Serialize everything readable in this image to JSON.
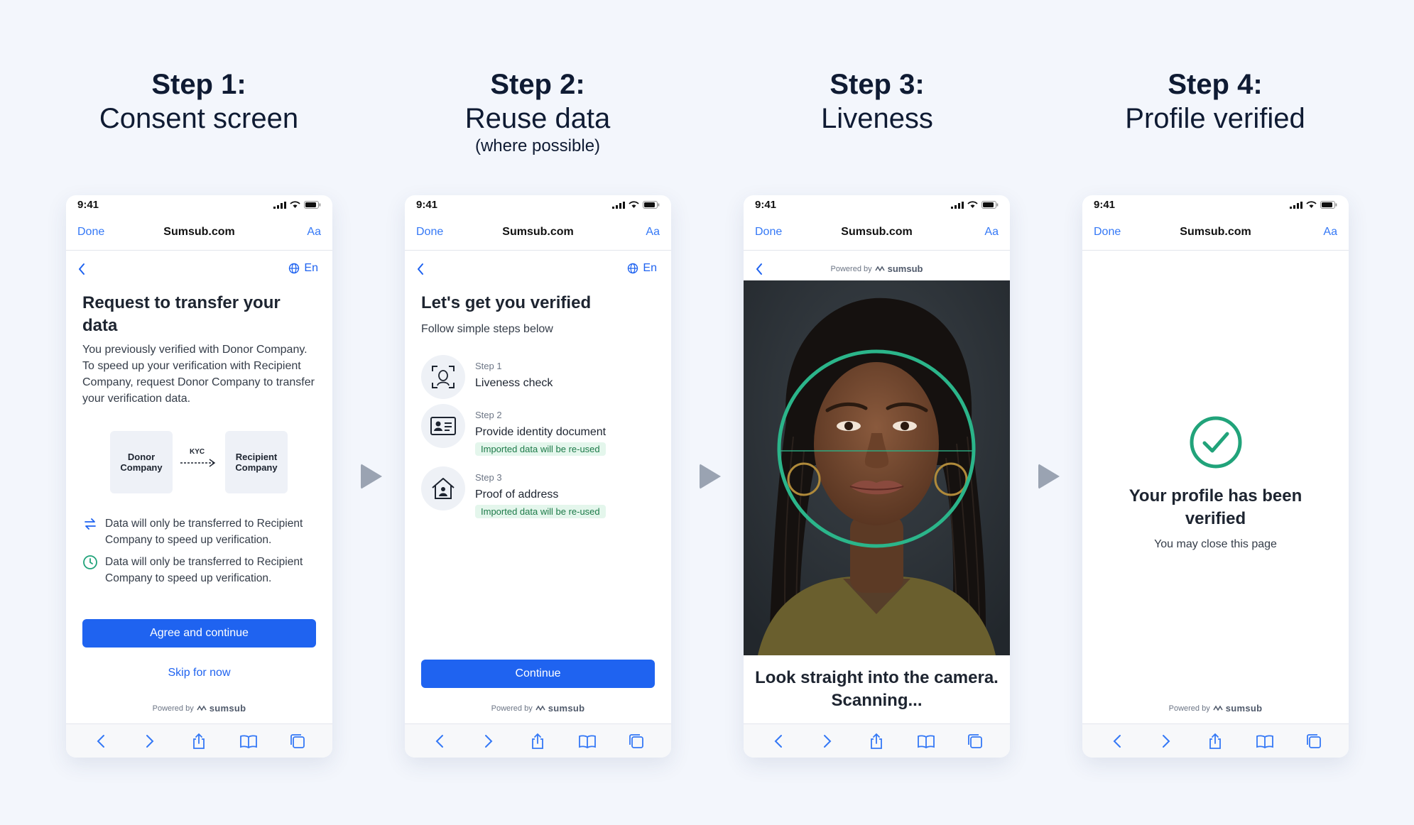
{
  "steps": [
    {
      "title": "Step 1:",
      "subtitle": "Consent screen",
      "note": ""
    },
    {
      "title": "Step 2:",
      "subtitle": "Reuse data",
      "note": "(where possible)"
    },
    {
      "title": "Step 3:",
      "subtitle": "Liveness",
      "note": ""
    },
    {
      "title": "Step 4:",
      "subtitle": "Profile verified",
      "note": ""
    }
  ],
  "status": {
    "time": "9:41"
  },
  "browser": {
    "done": "Done",
    "url": "Sumsub.com",
    "aa": "Aa"
  },
  "lang": "En",
  "powered": {
    "label": "Powered by",
    "brand": "sumsub"
  },
  "screen1": {
    "title": "Request to transfer your data",
    "body": "You previously verified with Donor Company. To speed up your verification with Recipient Company, request Donor Company to transfer your verification data.",
    "donor": "Donor Company",
    "recipient": "Recipient Company",
    "kyc": "KYC",
    "info1": "Data will only be transferred to Recipient Company to speed up verification.",
    "info2": "Data will only be transferred to Recipient Company to speed up verification.",
    "agree": "Agree and continue",
    "skip": "Skip for now"
  },
  "screen2": {
    "title": "Let's get you verified",
    "subtitle": "Follow simple steps below",
    "items": [
      {
        "label": "Step 1",
        "name": "Liveness check",
        "badge": ""
      },
      {
        "label": "Step 2",
        "name": "Provide identity document",
        "badge": "Imported data will be re-used"
      },
      {
        "label": "Step 3",
        "name": "Proof of address",
        "badge": "Imported data will be re-used"
      }
    ],
    "continue": "Continue"
  },
  "screen3": {
    "instruction": "Look straight into the camera. Scanning..."
  },
  "screen4": {
    "title": "Your profile has been verified",
    "subtitle": "You may close this page"
  },
  "colors": {
    "accent": "#1f63f0",
    "ios_blue": "#3478f6",
    "scan_ring": "#2bb58a",
    "success": "#21a37a",
    "badge_bg": "#e4f6ec",
    "badge_text": "#1c7a48"
  },
  "icons": [
    "back-icon",
    "globe-icon",
    "arrow-right-icon",
    "sync-icon",
    "clock-icon",
    "face-scan-icon",
    "id-card-icon",
    "home-icon",
    "check-circle-icon",
    "share-icon",
    "bookmarks-icon",
    "tabs-icon"
  ]
}
